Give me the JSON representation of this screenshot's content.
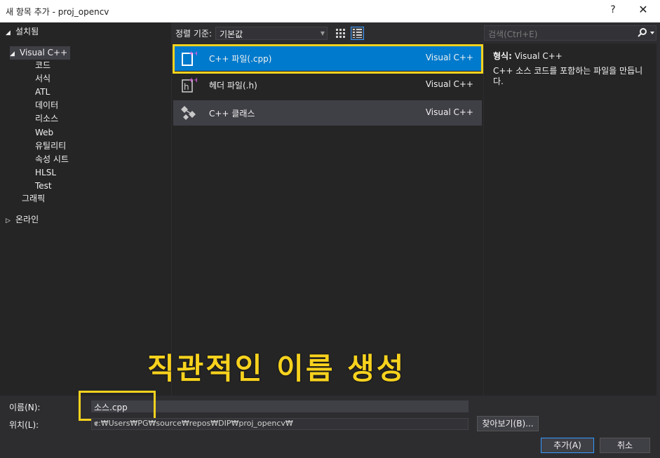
{
  "window": {
    "title": "새 항목 추가 - proj_opencv",
    "help": "?",
    "close": "✕"
  },
  "tree": {
    "installed": "설치됨",
    "visual_cpp": "Visual C++",
    "children": [
      "코드",
      "서식",
      "ATL",
      "데이터",
      "리소스",
      "Web",
      "유틸리티",
      "속성 시트",
      "HLSL",
      "Test"
    ],
    "graphics": "그래픽",
    "online": "온라인"
  },
  "toolbar": {
    "sort_label": "정렬 기준:",
    "sort_value": "기본값"
  },
  "search": {
    "placeholder": "검색(Ctrl+E)"
  },
  "templates": [
    {
      "name": "C++ 파일(.cpp)",
      "lang": "Visual C++"
    },
    {
      "name": "헤더 파일(.h)",
      "lang": "Visual C++"
    },
    {
      "name": "C++ 클래스",
      "lang": "Visual C++"
    }
  ],
  "info": {
    "type_label": "형식:",
    "type_value": "Visual C++",
    "description": "C++ 소스 코드를 포함하는 파일을 만듭니다."
  },
  "overlay": {
    "caption": "직관적인 이름 생성"
  },
  "form": {
    "name_label": "이름(N):",
    "name_value": "소스.cpp",
    "location_label": "위치(L):",
    "location_value": "c:₩Users₩PG₩source₩repos₩DIP₩proj_opencv₩",
    "browse": "찾아보기(B)...",
    "add": "추가(A)",
    "cancel": "취소"
  },
  "colors": {
    "accent": "#007acc",
    "highlight": "#f7d21e",
    "background": "#2d2d30"
  }
}
